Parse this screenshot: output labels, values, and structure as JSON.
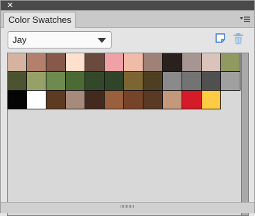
{
  "window": {
    "close_glyph": "✕"
  },
  "tab": {
    "label": "Color Swatches"
  },
  "panel_menu": {
    "icon": "panel-menu-icon"
  },
  "dropdown": {
    "selected": "Jay"
  },
  "toolbar": {
    "new_icon": "new-swatch-icon",
    "delete_icon": "trash-icon",
    "accent": "#3d7bd1"
  },
  "swatches": [
    "#d6b3a0",
    "#b3806d",
    "#87594a",
    "#ffe0cf",
    "#6a4a3c",
    "#f0a1a6",
    "#f0bba7",
    "#9f8177",
    "#2a211f",
    "#a69591",
    "#d9c3bb",
    "#8f9960",
    "#4b5330",
    "#96a167",
    "#6d8a4f",
    "#4c6a36",
    "#33482b",
    "#2f4429",
    "#7d6533",
    "#4f3f22",
    "#8a8a8a",
    "#737373",
    "#505050",
    "#a0a0a0",
    "#050505",
    "#ffffff",
    "#5d3a22",
    "#a68b7d",
    "#432a1e",
    "#98603c",
    "#764529",
    "#5a3a25",
    "#c4987a",
    "#d51b29",
    "#ffcb45"
  ]
}
